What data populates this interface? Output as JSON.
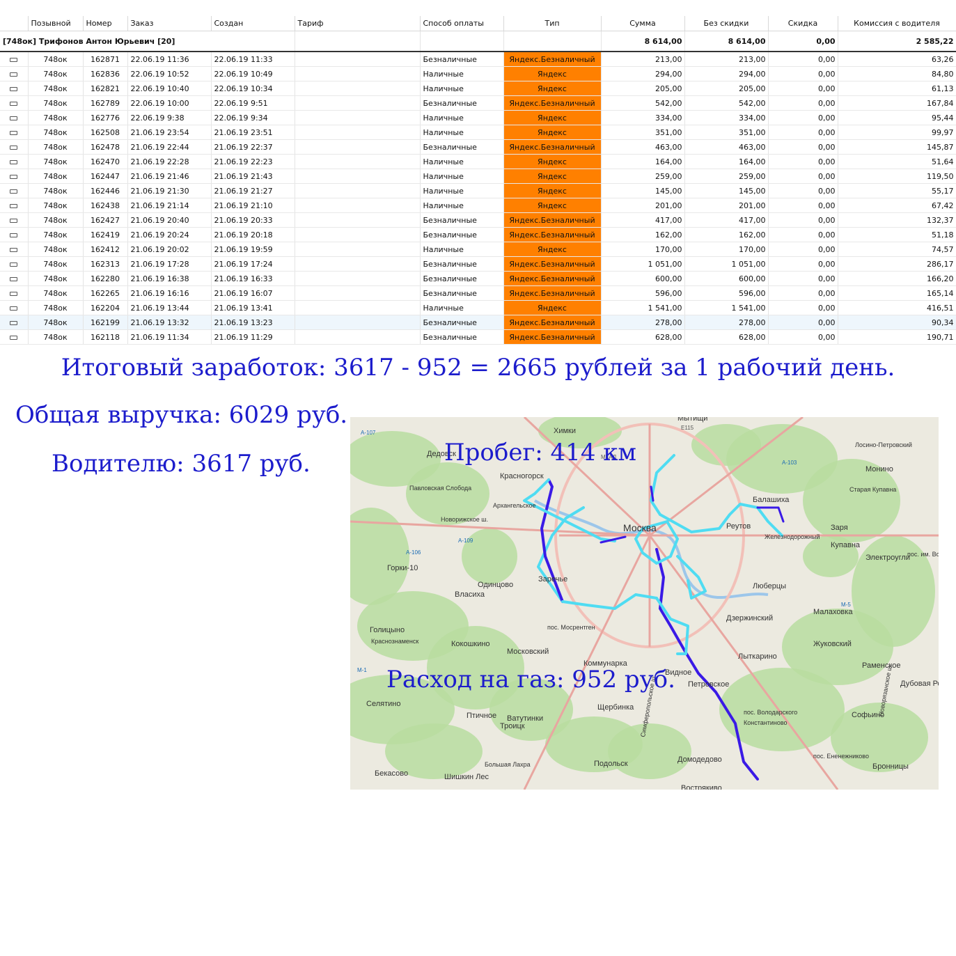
{
  "columns": {
    "callsign": "Позывной",
    "number": "Номер",
    "order": "Заказ",
    "created": "Создан",
    "tariff": "Тариф",
    "payment": "Способ оплаты",
    "type": "Тип",
    "sum": "Сумма",
    "no_discount": "Без скидки",
    "discount": "Скидка",
    "commission": "Комиссия с водителя"
  },
  "group": {
    "title": "[748ок] Трифонов Антон Юрьевич [20]",
    "sum": "8 614,00",
    "no_discount": "8 614,00",
    "discount": "0,00",
    "commission": "2 585,22"
  },
  "rows": [
    {
      "callsign": "748ок",
      "number": "162871",
      "order": "22.06.19 11:36",
      "created": "22.06.19 11:33",
      "tariff": "",
      "payment": "Безналичные",
      "type": "Яндекс.Безналичный",
      "sum": "213,00",
      "no_discount": "213,00",
      "discount": "0,00",
      "commission": "63,26"
    },
    {
      "callsign": "748ок",
      "number": "162836",
      "order": "22.06.19 10:52",
      "created": "22.06.19 10:49",
      "tariff": "",
      "payment": "Наличные",
      "type": "Яндекс",
      "sum": "294,00",
      "no_discount": "294,00",
      "discount": "0,00",
      "commission": "84,80"
    },
    {
      "callsign": "748ок",
      "number": "162821",
      "order": "22.06.19 10:40",
      "created": "22.06.19 10:34",
      "tariff": "",
      "payment": "Наличные",
      "type": "Яндекс",
      "sum": "205,00",
      "no_discount": "205,00",
      "discount": "0,00",
      "commission": "61,13"
    },
    {
      "callsign": "748ок",
      "number": "162789",
      "order": "22.06.19 10:00",
      "created": "22.06.19 9:51",
      "tariff": "",
      "payment": "Безналичные",
      "type": "Яндекс.Безналичный",
      "sum": "542,00",
      "no_discount": "542,00",
      "discount": "0,00",
      "commission": "167,84"
    },
    {
      "callsign": "748ок",
      "number": "162776",
      "order": "22.06.19 9:38",
      "created": "22.06.19 9:34",
      "tariff": "",
      "payment": "Наличные",
      "type": "Яндекс",
      "sum": "334,00",
      "no_discount": "334,00",
      "discount": "0,00",
      "commission": "95,44"
    },
    {
      "callsign": "748ок",
      "number": "162508",
      "order": "21.06.19 23:54",
      "created": "21.06.19 23:51",
      "tariff": "",
      "payment": "Наличные",
      "type": "Яндекс",
      "sum": "351,00",
      "no_discount": "351,00",
      "discount": "0,00",
      "commission": "99,97"
    },
    {
      "callsign": "748ок",
      "number": "162478",
      "order": "21.06.19 22:44",
      "created": "21.06.19 22:37",
      "tariff": "",
      "payment": "Безналичные",
      "type": "Яндекс.Безналичный",
      "sum": "463,00",
      "no_discount": "463,00",
      "discount": "0,00",
      "commission": "145,87"
    },
    {
      "callsign": "748ок",
      "number": "162470",
      "order": "21.06.19 22:28",
      "created": "21.06.19 22:23",
      "tariff": "",
      "payment": "Наличные",
      "type": "Яндекс",
      "sum": "164,00",
      "no_discount": "164,00",
      "discount": "0,00",
      "commission": "51,64"
    },
    {
      "callsign": "748ок",
      "number": "162447",
      "order": "21.06.19 21:46",
      "created": "21.06.19 21:43",
      "tariff": "",
      "payment": "Наличные",
      "type": "Яндекс",
      "sum": "259,00",
      "no_discount": "259,00",
      "discount": "0,00",
      "commission": "119,50"
    },
    {
      "callsign": "748ок",
      "number": "162446",
      "order": "21.06.19 21:30",
      "created": "21.06.19 21:27",
      "tariff": "",
      "payment": "Наличные",
      "type": "Яндекс",
      "sum": "145,00",
      "no_discount": "145,00",
      "discount": "0,00",
      "commission": "55,17"
    },
    {
      "callsign": "748ок",
      "number": "162438",
      "order": "21.06.19 21:14",
      "created": "21.06.19 21:10",
      "tariff": "",
      "payment": "Наличные",
      "type": "Яндекс",
      "sum": "201,00",
      "no_discount": "201,00",
      "discount": "0,00",
      "commission": "67,42"
    },
    {
      "callsign": "748ок",
      "number": "162427",
      "order": "21.06.19 20:40",
      "created": "21.06.19 20:33",
      "tariff": "",
      "payment": "Безналичные",
      "type": "Яндекс.Безналичный",
      "sum": "417,00",
      "no_discount": "417,00",
      "discount": "0,00",
      "commission": "132,37"
    },
    {
      "callsign": "748ок",
      "number": "162419",
      "order": "21.06.19 20:24",
      "created": "21.06.19 20:18",
      "tariff": "",
      "payment": "Безналичные",
      "type": "Яндекс.Безналичный",
      "sum": "162,00",
      "no_discount": "162,00",
      "discount": "0,00",
      "commission": "51,18"
    },
    {
      "callsign": "748ок",
      "number": "162412",
      "order": "21.06.19 20:02",
      "created": "21.06.19 19:59",
      "tariff": "",
      "payment": "Наличные",
      "type": "Яндекс",
      "sum": "170,00",
      "no_discount": "170,00",
      "discount": "0,00",
      "commission": "74,57"
    },
    {
      "callsign": "748ок",
      "number": "162313",
      "order": "21.06.19 17:28",
      "created": "21.06.19 17:24",
      "tariff": "",
      "payment": "Безналичные",
      "type": "Яндекс.Безналичный",
      "sum": "1 051,00",
      "no_discount": "1 051,00",
      "discount": "0,00",
      "commission": "286,17"
    },
    {
      "callsign": "748ок",
      "number": "162280",
      "order": "21.06.19 16:38",
      "created": "21.06.19 16:33",
      "tariff": "",
      "payment": "Безналичные",
      "type": "Яндекс.Безналичный",
      "sum": "600,00",
      "no_discount": "600,00",
      "discount": "0,00",
      "commission": "166,20"
    },
    {
      "callsign": "748ок",
      "number": "162265",
      "order": "21.06.19 16:16",
      "created": "21.06.19 16:07",
      "tariff": "",
      "payment": "Безналичные",
      "type": "Яндекс.Безналичный",
      "sum": "596,00",
      "no_discount": "596,00",
      "discount": "0,00",
      "commission": "165,14"
    },
    {
      "callsign": "748ок",
      "number": "162204",
      "order": "21.06.19 13:44",
      "created": "21.06.19 13:41",
      "tariff": "",
      "payment": "Наличные",
      "type": "Яндекс",
      "sum": "1 541,00",
      "no_discount": "1 541,00",
      "discount": "0,00",
      "commission": "416,51"
    },
    {
      "callsign": "748ок",
      "number": "162199",
      "order": "21.06.19 13:32",
      "created": "21.06.19 13:23",
      "tariff": "",
      "payment": "Безналичные",
      "type": "Яндекс.Безналичный",
      "sum": "278,00",
      "no_discount": "278,00",
      "discount": "0,00",
      "commission": "90,34",
      "selected": true
    },
    {
      "callsign": "748ок",
      "number": "162118",
      "order": "21.06.19 11:34",
      "created": "21.06.19 11:29",
      "tariff": "",
      "payment": "Безналичные",
      "type": "Яндекс.Безналичный",
      "sum": "628,00",
      "no_discount": "628,00",
      "discount": "0,00",
      "commission": "190,71"
    }
  ],
  "headlines": {
    "earnings": "Итоговый заработок: 3617 - 952 = 2665 рублей за 1 рабочий день.",
    "revenue": "Общая выручка: 6029 руб.",
    "driver": "Водителю: 3617 руб.",
    "mileage": "Пробег: 414 км",
    "gas": "Расход на газ: 952 руб."
  },
  "map": {
    "places": [
      "Мытищи",
      "Химки",
      "Лосино-Петровский",
      "Дедовск",
      "Красногорск",
      "Монино",
      "Павловская Слобода",
      "Архангельское",
      "Старая Купавна",
      "Балашиха",
      "Новорижское ш.",
      "Москва",
      "Реутов",
      "Железнодорожный",
      "Заря",
      "Купавна",
      "Горки-10",
      "Электроугли",
      "пос. им. Воровского",
      "Одинцово",
      "Заречье",
      "Люберцы",
      "Власиха",
      "Малаховка",
      "Дзержинский",
      "Голицыно",
      "пос. Мосрентген",
      "Краснознаменск",
      "Кокошкино",
      "Жуковский",
      "Московский",
      "Коммунарка",
      "Лыткарино",
      "Раменское",
      "Видное",
      "Петровское",
      "Дубовая Роща",
      "Селятино",
      "Щербинка",
      "пос. Володарского",
      "Софьино",
      "Константиново",
      "Ватутинки",
      "Троицк",
      "Птичное",
      "Домодедово",
      "пос. Ененежниково",
      "Бронницы",
      "Подольск",
      "Вострякиво",
      "Шишкин Лес",
      "Бекасово",
      "Большая Лахра",
      "Симферопольское ш.",
      "Новорязанское ш."
    ],
    "roads": [
      "МКАД",
      "E115",
      "A-107",
      "A-103",
      "A-109",
      "A-106",
      "M-5",
      "M-1"
    ],
    "colors": {
      "route_main": "#3a1ae6",
      "route_alt": "#4fdcf2",
      "forest": "#b9dda0",
      "water": "#9cc6ea"
    }
  }
}
